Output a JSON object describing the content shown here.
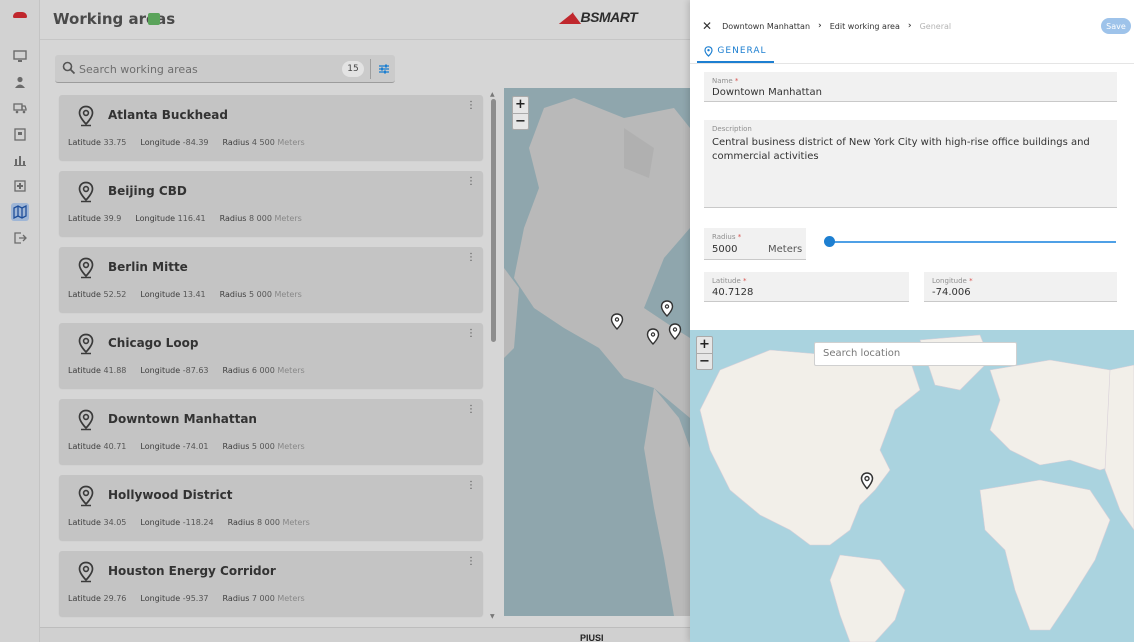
{
  "header": {
    "title": "Working areas",
    "brand": "BSMART",
    "footer_logo": "PIUSI"
  },
  "rail": {
    "items": [
      "monitor-icon",
      "user-icon",
      "truck-icon",
      "building-icon",
      "bar-chart-icon",
      "device-icon",
      "map-icon",
      "exit-icon"
    ],
    "active": "map-icon"
  },
  "search": {
    "placeholder": "Search working areas",
    "count": "15"
  },
  "cards": {
    "lat_label": "Latitude",
    "lon_label": "Longitude",
    "radius_label": "Radius",
    "unit": "Meters",
    "items": [
      {
        "name": "Atlanta Buckhead",
        "lat": "33.75",
        "lon": "-84.39",
        "radius": "4 500"
      },
      {
        "name": "Beijing CBD",
        "lat": "39.9",
        "lon": "116.41",
        "radius": "8 000"
      },
      {
        "name": "Berlin Mitte",
        "lat": "52.52",
        "lon": "13.41",
        "radius": "5 000"
      },
      {
        "name": "Chicago Loop",
        "lat": "41.88",
        "lon": "-87.63",
        "radius": "6 000"
      },
      {
        "name": "Downtown Manhattan",
        "lat": "40.71",
        "lon": "-74.01",
        "radius": "5 000"
      },
      {
        "name": "Hollywood District",
        "lat": "34.05",
        "lon": "-118.24",
        "radius": "8 000"
      },
      {
        "name": "Houston Energy Corridor",
        "lat": "29.76",
        "lon": "-95.37",
        "radius": "7 000"
      }
    ]
  },
  "panel": {
    "breadcrumb": [
      "Downtown Manhattan",
      "Edit working area",
      "General"
    ],
    "save_label": "Save",
    "tab_label": "GENERAL",
    "name_label": "Name",
    "name_value": "Downtown Manhattan",
    "description_label": "Description",
    "description_value": "Central business district of New York City with high-rise office buildings and commercial activities",
    "radius_label": "Radius",
    "radius_value": "5000",
    "radius_unit": "Meters",
    "radius_slider_fraction": 0.0,
    "latitude_label": "Latitude",
    "latitude_value": "40.7128",
    "longitude_label": "Longitude",
    "longitude_value": "-74.006",
    "map_search_placeholder": "Search location"
  },
  "map": {
    "zoom_in": "+",
    "zoom_out": "−",
    "water_color": "#aad3df",
    "land_color": "#f2efe9",
    "pin_color": "#333333"
  }
}
